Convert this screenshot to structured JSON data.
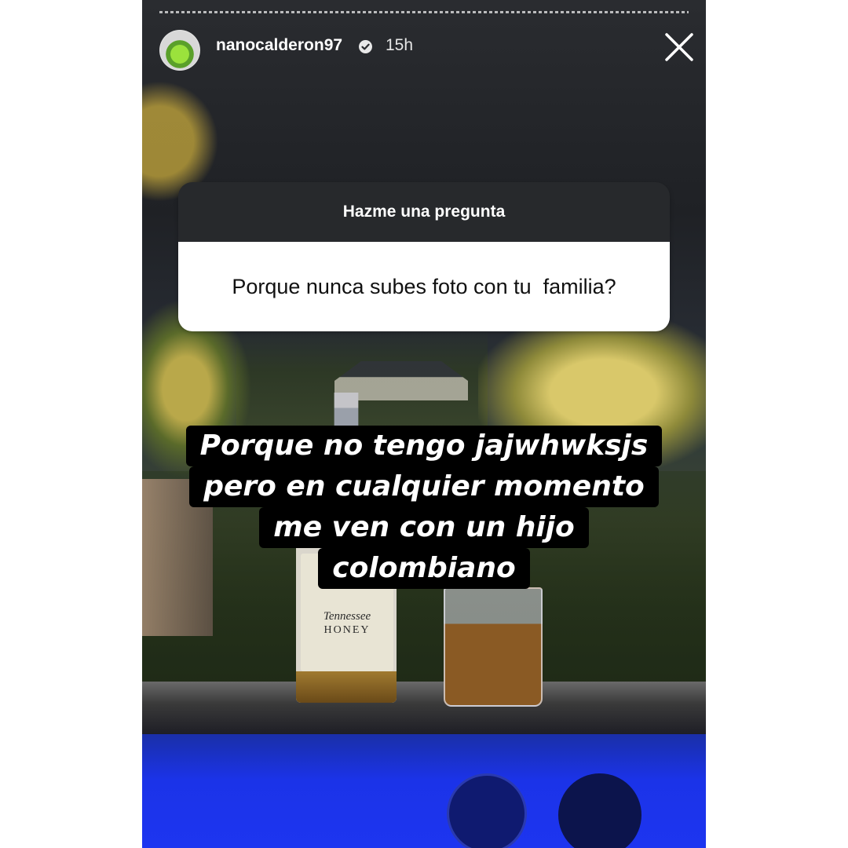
{
  "header": {
    "username": "nanocalderon97",
    "verified": true,
    "time": "15h"
  },
  "question": {
    "title": "Hazme una pregunta",
    "text": "Porque nunca subes foto con tu  familia?"
  },
  "answer": {
    "lines": [
      "Porque no tengo jajwhwksjs",
      "pero en cualquier momento",
      "me ven con un hijo",
      "colombiano"
    ]
  },
  "bottle": {
    "label_line1": "Tennessee",
    "label_line2": "HONEY"
  },
  "colors": {
    "question_header_bg": "#27292c",
    "answer_highlight": "#000000",
    "pool_blue": "#1d35f0"
  },
  "icons": [
    "close-icon",
    "verified-icon"
  ]
}
